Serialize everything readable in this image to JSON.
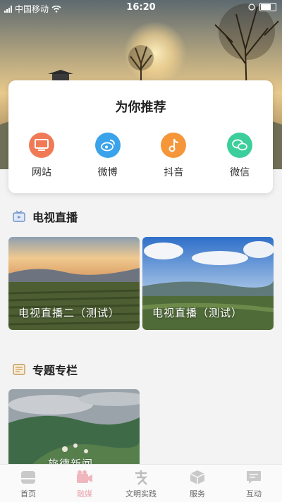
{
  "status_bar": {
    "carrier": "中国移动",
    "time": "16:20",
    "signal_icon": "signal-bars-icon",
    "wifi_icon": "wifi-icon",
    "battery_icon": "battery-icon"
  },
  "recommend": {
    "title": "为你推荐",
    "items": [
      {
        "label": "网站",
        "icon": "monitor-icon",
        "color": "#f07a55"
      },
      {
        "label": "微博",
        "icon": "weibo-icon",
        "color": "#3aa3ea"
      },
      {
        "label": "抖音",
        "icon": "music-note-icon",
        "color": "#f5963a"
      },
      {
        "label": "微信",
        "icon": "wechat-icon",
        "color": "#3ccf9c"
      }
    ]
  },
  "tv_live": {
    "title": "电视直播",
    "icon": "tv-icon",
    "cards": [
      {
        "label": "电视直播二（测试）"
      },
      {
        "label": "电视直播（测试）"
      }
    ]
  },
  "special": {
    "title": "专题专栏",
    "icon": "newspaper-icon",
    "cards": [
      {
        "label": "旅德新闻"
      }
    ]
  },
  "bottom_nav": {
    "items": [
      {
        "label": "首页",
        "icon": "home-icon",
        "active": false
      },
      {
        "label": "融媒",
        "icon": "video-camera-icon",
        "active": true
      },
      {
        "label": "文明实践",
        "icon": "calligraphy-icon",
        "active": false
      },
      {
        "label": "服务",
        "icon": "cube-icon",
        "active": false
      },
      {
        "label": "互动",
        "icon": "chat-icon",
        "active": false
      }
    ],
    "active_color": "#e9a4ad",
    "inactive_color": "#666666"
  }
}
